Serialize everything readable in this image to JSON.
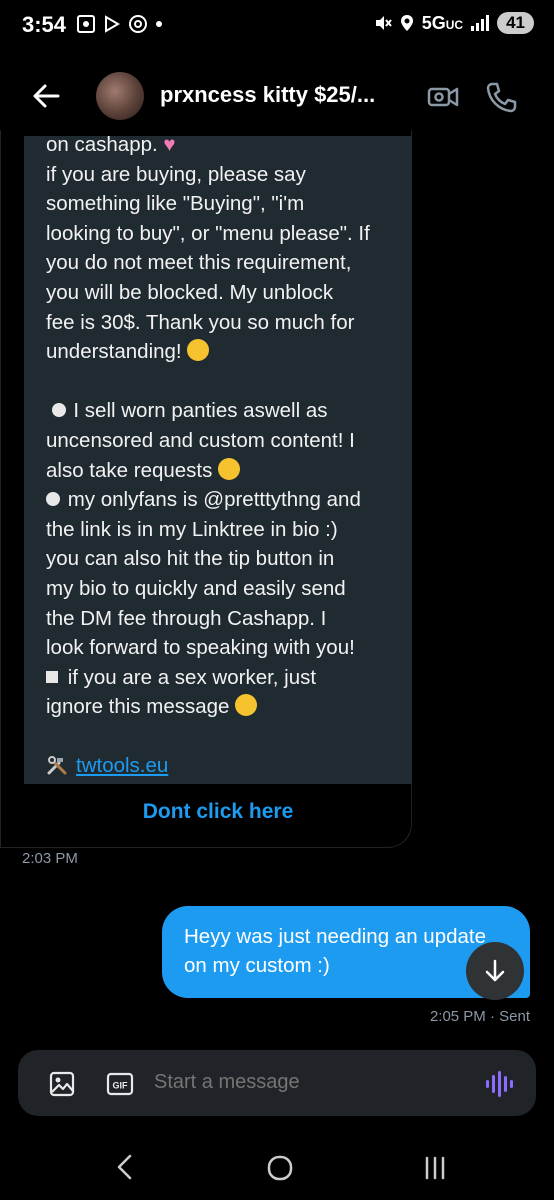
{
  "status_bar": {
    "time": "3:54",
    "network": "5G",
    "network_sub": "UC",
    "battery": "41"
  },
  "header": {
    "title": "prxncess kitty $25/..."
  },
  "received_message": {
    "lines_1": [
      "on cashapp. ",
      "if you are buying, please say",
      "something like \"Buying\", \"i'm",
      "looking to buy\", or \"menu please\". If",
      "you do not meet this requirement,",
      "you will be blocked. My unblock",
      "fee is 30$. Thank you so much for",
      "understanding! "
    ],
    "lines_2": [
      " I sell worn panties aswell as",
      "uncensored and custom content! I",
      "also take requests ",
      " my onlyfans is @pretttythng and",
      "the link is in my Linktree in bio :)",
      "you can also hit the tip button in",
      "my bio to quickly and easily send",
      "the DM fee through Cashapp. I",
      "look forward to speaking with you!",
      " if you are a sex worker, just",
      "ignore this message "
    ],
    "link_text": "twtools.eu",
    "button_label": "Dont click here",
    "timestamp": "2:03 PM"
  },
  "sent_message": {
    "lines": [
      "Heyy was just needing an update",
      "on my custom :)"
    ],
    "timestamp": "2:05 PM · Sent"
  },
  "composer": {
    "placeholder": "Start a message",
    "gif_label": "GIF"
  },
  "colors": {
    "accent": "#1d9bf0",
    "card_bg": "#202a31",
    "composer_bg": "#202327",
    "muted_text": "#8b98a5",
    "voice_icon": "#8e6bff"
  },
  "icons": {
    "back": "arrow-left-icon",
    "video": "video-call-icon",
    "call": "phone-icon",
    "image": "image-icon",
    "gif": "gif-icon",
    "voice": "voice-wave-icon",
    "scroll_down": "arrow-down-icon"
  }
}
